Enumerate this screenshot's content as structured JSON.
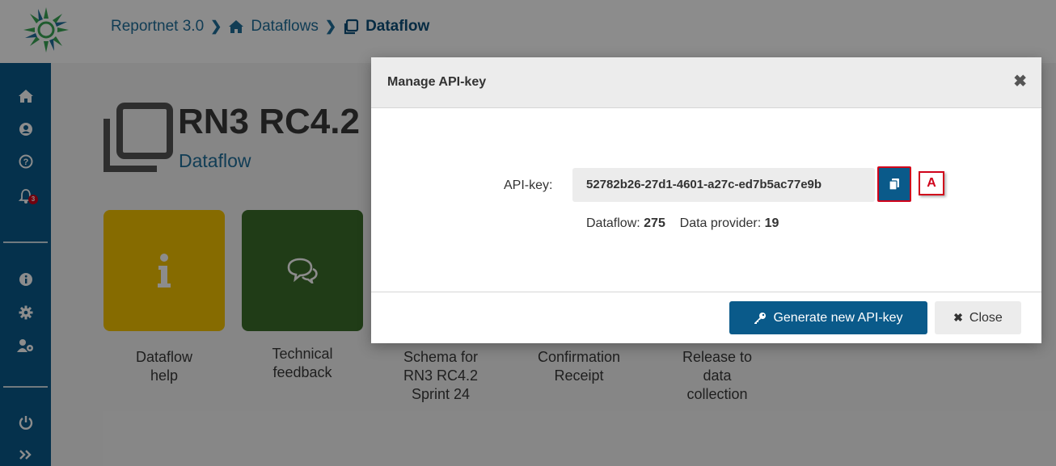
{
  "breadcrumb": {
    "home_link": "Reportnet 3.0",
    "dataflows_link": "Dataflows",
    "current": "Dataflow"
  },
  "header": {
    "title": "RN3 RC4.2",
    "subtitle": "Dataflow"
  },
  "sidebar": {
    "notification_count": "3",
    "icons": [
      "home-icon",
      "user-icon",
      "help-icon",
      "bell-icon",
      "info-icon",
      "gear-icon",
      "user-settings-icon",
      "power-icon",
      "expand-icon"
    ]
  },
  "tiles": [
    {
      "label_line1": "Dataflow",
      "label_line2": "help",
      "icon": "info-icon",
      "color": "#f5c400"
    },
    {
      "label_line1": "Technical",
      "label_line2": "feedback",
      "icon": "comments-icon",
      "color": "#3b6e2a"
    }
  ],
  "tile_labels_extra": [
    {
      "l1": "Schema for",
      "l2": "RN3 RC4.2",
      "l3": "Sprint 24"
    },
    {
      "l1": "Confirmation",
      "l2": "Receipt",
      "l3": ""
    },
    {
      "l1": "Release to",
      "l2": "data",
      "l3": "collection"
    }
  ],
  "modal": {
    "title": "Manage API-key",
    "api_key_label": "API-key:",
    "api_key_value": "52782b26-27d1-4601-a27c-ed7b5ac77e9b",
    "dataflow_label": "Dataflow:",
    "dataflow_value": "275",
    "provider_label": "Data provider:",
    "provider_value": "19",
    "generate_button": "Generate new API-key",
    "close_button": "Close",
    "annotation_marker": "A"
  },
  "colors": {
    "primary": "#0a5a8a",
    "accent_red": "#d0021b",
    "help_tile": "#f5c400",
    "feedback_tile": "#3b6e2a"
  }
}
